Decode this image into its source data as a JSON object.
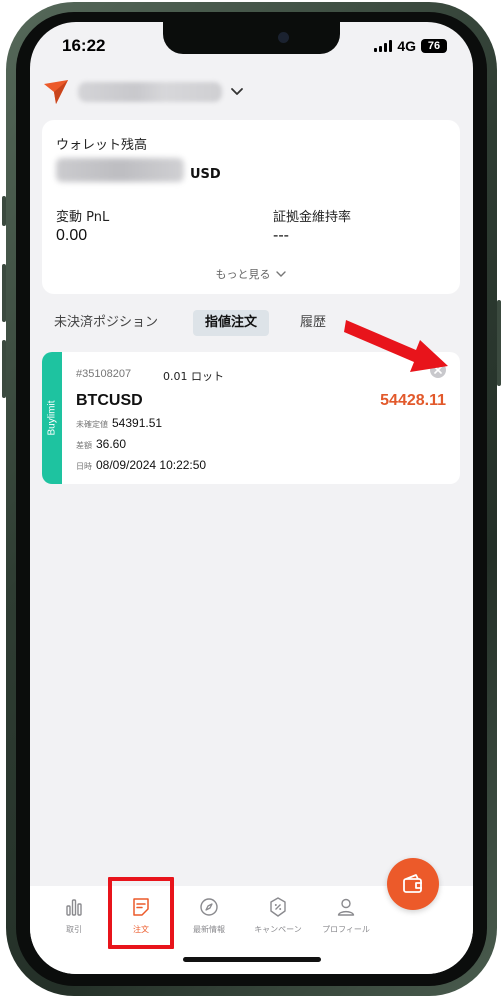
{
  "status_bar": {
    "time": "16:22",
    "network": "4G",
    "battery": "76"
  },
  "header": {
    "account_name": ""
  },
  "wallet": {
    "label": "ウォレット残高",
    "balance": "",
    "currency": "USD",
    "pnl_label": "変動 PnL",
    "pnl_value": "0.00",
    "margin_label": "証拠金維持率",
    "margin_value": "---",
    "more_label": "もっと見る"
  },
  "tabs": [
    {
      "label": "未決済ポジション",
      "active": false
    },
    {
      "label": "指値注文",
      "active": true
    },
    {
      "label": "履歴",
      "active": false
    }
  ],
  "orders": [
    {
      "side": "Buylimit",
      "id": "#35108207",
      "lot": "0.01 ロット",
      "symbol": "BTCUSD",
      "price": "54428.11",
      "current_label": "未確定値",
      "current_value": "54391.51",
      "diff_label": "差額",
      "diff_value": "36.60",
      "date_label": "日時",
      "date_value": "08/09/2024 10:22:50"
    }
  ],
  "bottom_nav": [
    {
      "label": "取引",
      "icon": "chart-bars-icon"
    },
    {
      "label": "注文",
      "icon": "order-note-icon",
      "active": true
    },
    {
      "label": "最新情報",
      "icon": "compass-icon"
    },
    {
      "label": "キャンペーン",
      "icon": "coupon-icon"
    },
    {
      "label": "プロフィール",
      "icon": "user-icon"
    }
  ],
  "colors": {
    "accent": "#ec5a2a",
    "buy_strip": "#1ec3a0",
    "price": "#e2592b",
    "highlight": "#e8141b",
    "arrow": "#e8141b"
  }
}
